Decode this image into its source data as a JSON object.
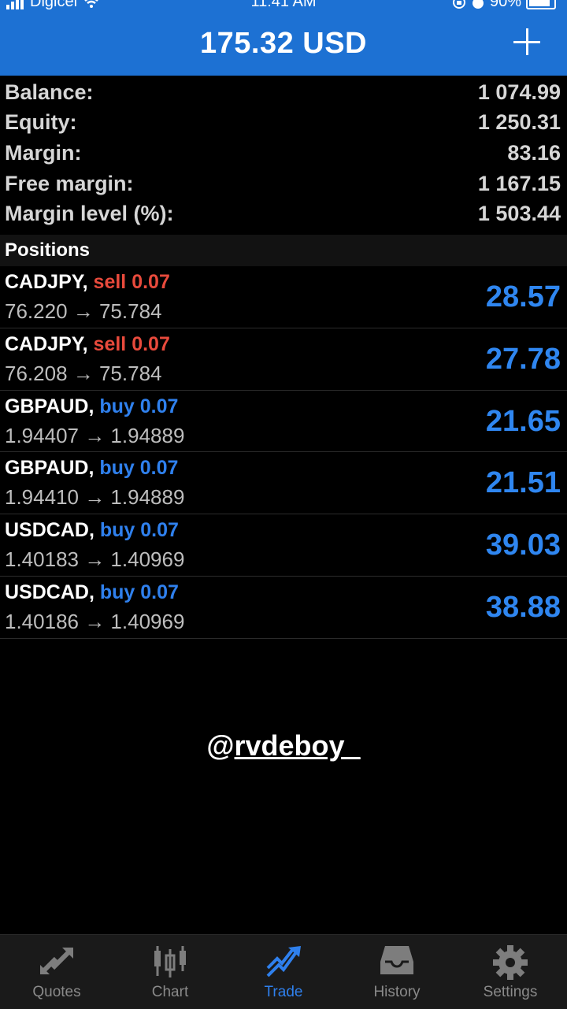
{
  "status_bar": {
    "carrier": "Digicel",
    "time": "11:41 AM",
    "battery": "90%"
  },
  "header": {
    "title": "175.32 USD"
  },
  "summary": [
    {
      "label": "Balance:",
      "value": "1 074.99"
    },
    {
      "label": "Equity:",
      "value": "1 250.31"
    },
    {
      "label": "Margin:",
      "value": "83.16"
    },
    {
      "label": "Free margin:",
      "value": "1 167.15"
    },
    {
      "label": "Margin level (%):",
      "value": "1 503.44"
    }
  ],
  "positions_title": "Positions",
  "positions": [
    {
      "symbol": "CADJPY,",
      "side": "sell 0.07",
      "prices": "76.220 → 75.784",
      "profit": "28.57"
    },
    {
      "symbol": "CADJPY,",
      "side": "sell 0.07",
      "prices": "76.208 → 75.784",
      "profit": "27.78"
    },
    {
      "symbol": "GBPAUD,",
      "side": "buy 0.07",
      "prices": "1.94407 → 1.94889",
      "profit": "21.65"
    },
    {
      "symbol": "GBPAUD,",
      "side": "buy 0.07",
      "prices": "1.94410 → 1.94889",
      "profit": "21.51"
    },
    {
      "symbol": "USDCAD,",
      "side": "buy 0.07",
      "prices": "1.40183 → 1.40969",
      "profit": "39.03"
    },
    {
      "symbol": "USDCAD,",
      "side": "buy 0.07",
      "prices": "1.40186 → 1.40969",
      "profit": "38.88"
    }
  ],
  "watermark": {
    "at": "@",
    "handle": "rvdeboy_"
  },
  "tabs": [
    {
      "label": "Quotes",
      "icon": "quotes-icon"
    },
    {
      "label": "Chart",
      "icon": "chart-icon"
    },
    {
      "label": "Trade",
      "icon": "trade-icon"
    },
    {
      "label": "History",
      "icon": "history-icon"
    },
    {
      "label": "Settings",
      "icon": "settings-icon"
    }
  ],
  "active_tab": "Trade",
  "colors": {
    "header": "#1d71d3",
    "sell": "#e84a3c",
    "buy": "#2f80ed",
    "profit": "#2f86f0"
  }
}
